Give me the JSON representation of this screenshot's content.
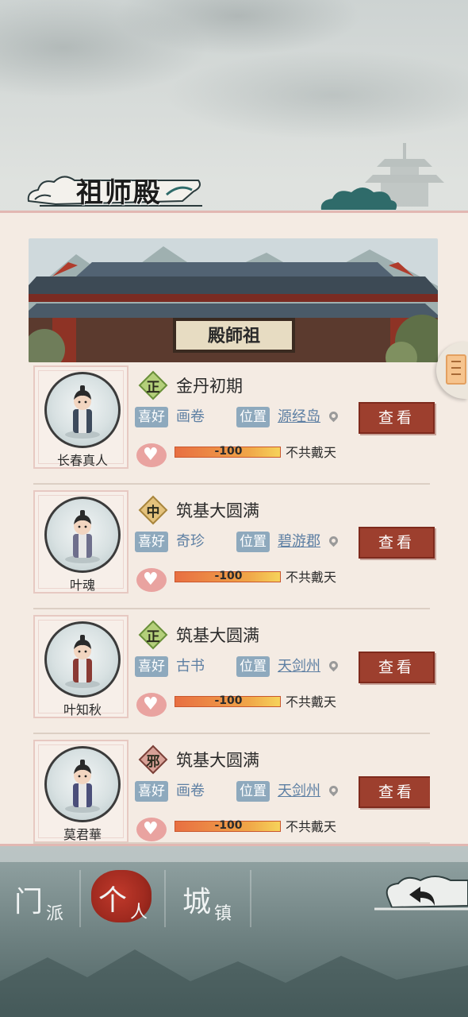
{
  "title": "祖师殿",
  "hall_plaque": "殿師祖",
  "characters": [
    {
      "name": "长春真人",
      "faction": "正",
      "faction_type": "righteous",
      "realm": "金丹初期",
      "hobby_label": "喜好",
      "hobby": "画卷",
      "location_label": "位置",
      "location": "源经岛",
      "favor": "-100",
      "relation": "不共戴天",
      "button": "查看",
      "robe": "#3d4a5c"
    },
    {
      "name": "叶魂",
      "faction": "中",
      "faction_type": "neutral",
      "realm": "筑基大圆满",
      "hobby_label": "喜好",
      "hobby": "奇珍",
      "location_label": "位置",
      "location": "碧游郡",
      "favor": "-100",
      "relation": "不共戴天",
      "button": "查看",
      "robe": "#6e6f8c"
    },
    {
      "name": "叶知秋",
      "faction": "正",
      "faction_type": "righteous",
      "realm": "筑基大圆满",
      "hobby_label": "喜好",
      "hobby": "古书",
      "location_label": "位置",
      "location": "天剑州",
      "favor": "-100",
      "relation": "不共戴天",
      "button": "查看",
      "robe": "#8a3a34"
    },
    {
      "name": "莫君華",
      "faction": "邪",
      "faction_type": "evil",
      "realm": "筑基大圆满",
      "hobby_label": "喜好",
      "hobby": "画卷",
      "location_label": "位置",
      "location": "天剑州",
      "favor": "-100",
      "relation": "不共戴天",
      "button": "查看",
      "robe": "#4b4f7a"
    }
  ],
  "nav": {
    "sect": {
      "big": "门",
      "small": "派"
    },
    "personal": {
      "big": "个",
      "small": "人"
    },
    "town": {
      "big": "城",
      "small": "镇"
    }
  },
  "colors": {
    "button": "#9d3f2e",
    "tag": "#8ea9bd",
    "link": "#5d7fa3",
    "panel": "#f4ebe3"
  }
}
